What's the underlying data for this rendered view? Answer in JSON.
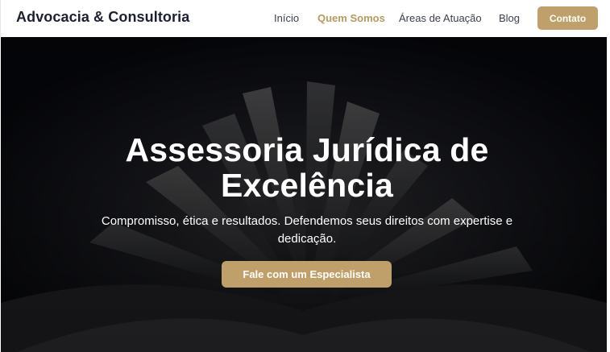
{
  "header": {
    "brand": "Advocacia & Consultoria",
    "nav": {
      "inicio": "Início",
      "quem_somos": "Quem Somos",
      "areas": "Áreas de Atuação",
      "blog": "Blog"
    },
    "contact_label": "Contato"
  },
  "hero": {
    "title_line1": "Assessoria Jurídica de",
    "title_line2": "Excelência",
    "subtitle_line1": "Compromisso, ética e resultados. Defendemos seus direitos com expertise e",
    "subtitle_line2": "dedicação.",
    "cta_label": "Fale com um Especialista"
  },
  "colors": {
    "accent": "#bfa06a",
    "active_nav": "#b89a5c",
    "hero_bg": "#0b0c12",
    "brand_text": "#1c2130"
  }
}
